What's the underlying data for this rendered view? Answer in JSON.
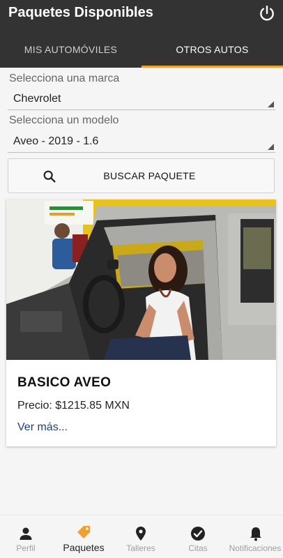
{
  "app_bar": {
    "title": "Paquetes Disponibles",
    "icon": "power-icon"
  },
  "tabs": [
    {
      "label": "MIS AUTOMÓVILES",
      "selected": false
    },
    {
      "label": "OTROS AUTOS",
      "selected": true
    }
  ],
  "colors": {
    "appbar": "#333333",
    "tab_indicator": "#f0a030",
    "link": "#1f3f7a",
    "accent_orange": "#f0a030"
  },
  "filters": {
    "brand_label": "Selecciona una marca",
    "brand_value": "Chevrolet",
    "model_label": "Selecciona un modelo",
    "model_value": "Aveo - 2019 - 1.6"
  },
  "search_button": {
    "label": "BUSCAR PAQUETE",
    "icon": "search-icon"
  },
  "package_card": {
    "title": "BASICO AVEO",
    "price": "Precio: $1215.85 MXN",
    "more_link": "Ver más...",
    "image": "woman-in-car-photo"
  },
  "bottom_nav": [
    {
      "label": "Perfil",
      "icon": "person-icon",
      "active": false
    },
    {
      "label": "Paquetes",
      "icon": "tag-icon",
      "active": true
    },
    {
      "label": "Talleres",
      "icon": "location-pin-icon",
      "active": false
    },
    {
      "label": "Citas",
      "icon": "check-circle-icon",
      "active": false
    },
    {
      "label": "Notificaciones",
      "icon": "bell-icon",
      "active": false
    }
  ]
}
